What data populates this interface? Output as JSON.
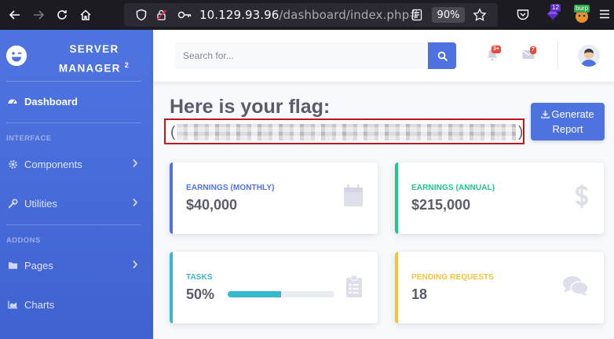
{
  "browser": {
    "url_host": "10.129.93.96",
    "url_path": "/dashboard/index.php#",
    "zoom": "90%",
    "extension_badge": "12",
    "burp_label": "burp"
  },
  "sidebar": {
    "brand_line1": "SERVER",
    "brand_line2": "MANAGER",
    "brand_sup": "2",
    "items": [
      {
        "label": "Dashboard",
        "icon": "tachometer-icon"
      },
      {
        "label": "Components",
        "icon": "cog-icon"
      },
      {
        "label": "Utilities",
        "icon": "wrench-icon"
      },
      {
        "label": "Pages",
        "icon": "folder-icon"
      },
      {
        "label": "Charts",
        "icon": "chart-area-icon"
      }
    ],
    "headings": [
      "INTERFACE",
      "ADDONS"
    ]
  },
  "topbar": {
    "search_placeholder": "Search for...",
    "alerts_count": "3+",
    "messages_count": "7"
  },
  "main": {
    "heading": "Here is your flag:",
    "flag_open": "(",
    "flag_close": ")",
    "generate_report": "Generate Report"
  },
  "cards": [
    {
      "label": "EARNINGS (MONTHLY)",
      "value": "$40,000",
      "color": "#4e73df",
      "icon": "calendar-icon"
    },
    {
      "label": "EARNINGS (ANNUAL)",
      "value": "$215,000",
      "color": "#1cc88a",
      "icon": "dollar-icon"
    },
    {
      "label": "TASKS",
      "value": "50%",
      "color": "#36b9cc",
      "icon": "clipboard-list-icon",
      "progress": 0.5
    },
    {
      "label": "PENDING REQUESTS",
      "value": "18",
      "color": "#f6c23e",
      "icon": "comments-icon"
    }
  ],
  "colors": {
    "primary": "#4e73df",
    "danger": "#e74a3b",
    "text": "#5a5c69"
  }
}
